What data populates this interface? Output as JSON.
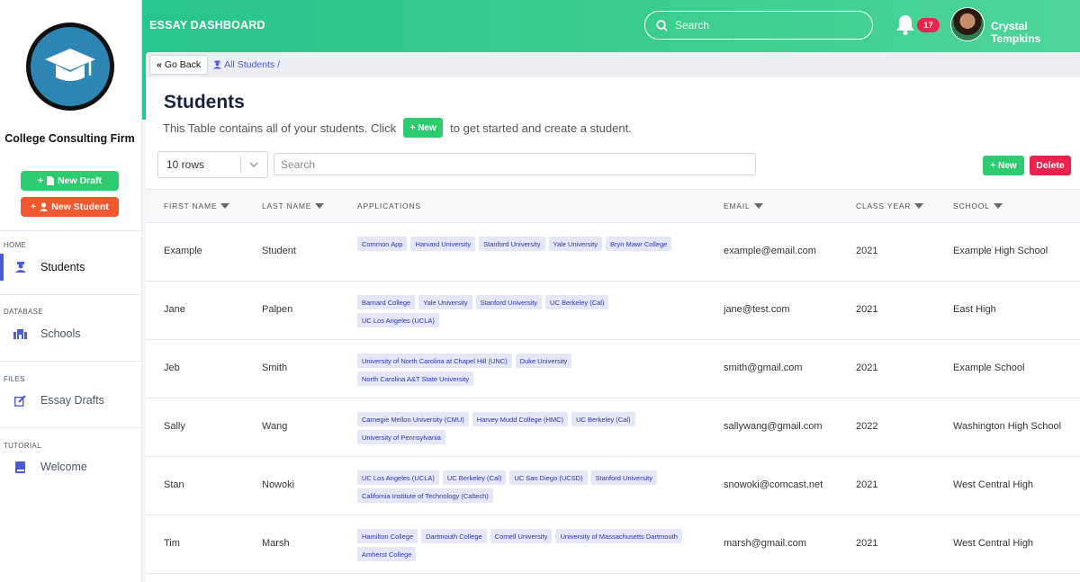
{
  "sidebar": {
    "firm_name": "College Consulting Firm",
    "new_draft": "New Draft",
    "new_student": "New Student",
    "sections": [
      {
        "label": "HOME",
        "item": "Students",
        "icon": "user-graduate-icon",
        "active": true
      },
      {
        "label": "DATABASE",
        "item": "Schools",
        "icon": "school-icon",
        "active": false
      },
      {
        "label": "FILES",
        "item": "Essay Drafts",
        "icon": "edit-icon",
        "active": false
      },
      {
        "label": "TUTORIAL",
        "item": "Welcome",
        "icon": "book-icon",
        "active": false
      }
    ]
  },
  "header": {
    "title": "ESSAY DASHBOARD",
    "search_placeholder": "Search",
    "notification_count": "17",
    "user_name": "Crystal Tempkins"
  },
  "breadcrumb": {
    "go_back": "Go Back",
    "path": "All Students /"
  },
  "page": {
    "title": "Students",
    "subtitle_before": "This Table contains all of your students. Click",
    "subtitle_button": "+ New",
    "subtitle_after": "to get started and create a student."
  },
  "controls": {
    "rows_selected": "10 rows",
    "search_placeholder": "Search",
    "new_label": "+ New",
    "delete_label": "Delete"
  },
  "table": {
    "columns": [
      "FIRST NAME",
      "LAST NAME",
      "APPLICATIONS",
      "EMAIL",
      "CLASS YEAR",
      "SCHOOL"
    ],
    "rows": [
      {
        "first": "Example",
        "last": "Student",
        "apps": [
          "Common App",
          "Harvard University",
          "Stanford University",
          "Yale University",
          "Bryn Mawr College"
        ],
        "email": "example@email.com",
        "year": "2021",
        "school": "Example High School"
      },
      {
        "first": "Jane",
        "last": "Palpen",
        "apps": [
          "Barnard College",
          "Yale University",
          "Stanford University",
          "UC Berkeley (Cal)",
          "UC Los Angeles (UCLA)"
        ],
        "email": "jane@test.com",
        "year": "2021",
        "school": "East High"
      },
      {
        "first": "Jeb",
        "last": "Smith",
        "apps": [
          "University of North Carolina at Chapel Hill (UNC)",
          "Duke University",
          "North Carolina A&T State University"
        ],
        "email": "smith@gmail.com",
        "year": "2021",
        "school": "Example School"
      },
      {
        "first": "Sally",
        "last": "Wang",
        "apps": [
          "Carnegie Mellon University (CMU)",
          "Harvey Mudd College (HMC)",
          "UC Berkeley (Cal)",
          "University of Pennsylvania"
        ],
        "email": "sallywang@gmail.com",
        "year": "2022",
        "school": "Washington High School"
      },
      {
        "first": "Stan",
        "last": "Nowoki",
        "apps": [
          "UC Los Angeles (UCLA)",
          "UC Berkeley (Cal)",
          "UC San Diego (UCSD)",
          "Stanford University",
          "California Institute of Technology (Caltech)"
        ],
        "email": "snowoki@comcast.net",
        "year": "2021",
        "school": "West Central High"
      },
      {
        "first": "Tim",
        "last": "Marsh",
        "apps": [
          "Hamilton College",
          "Dartmouth College",
          "Cornell University",
          "University of Massachusetts Dartmouth",
          "Amherst College"
        ],
        "email": "marsh@gmail.com",
        "year": "2021",
        "school": "West Central High"
      }
    ]
  },
  "colors": {
    "accent": "#2ecc71",
    "danger": "#e8234e",
    "brand_blue": "#4a5ad8",
    "new_student": "#f1582d"
  }
}
